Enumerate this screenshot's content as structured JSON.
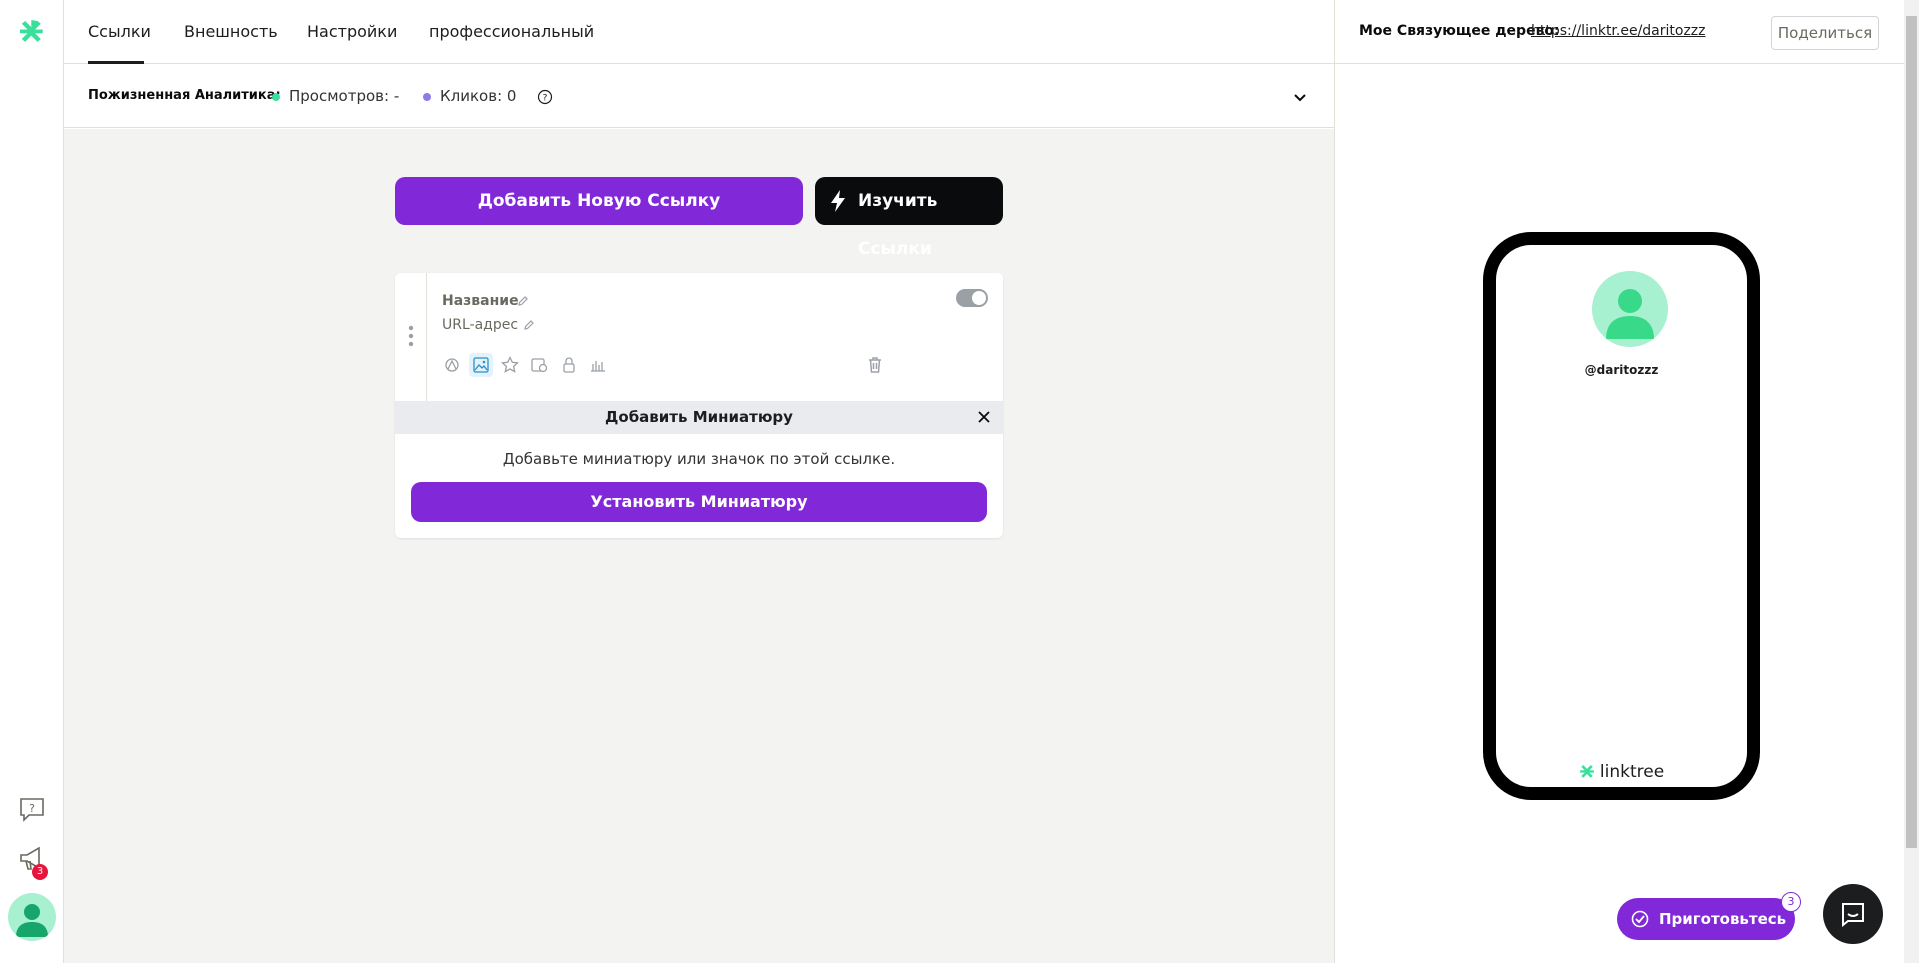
{
  "nav": {
    "tabs": [
      {
        "label": "Ссылки",
        "active": true
      },
      {
        "label": "Внешность"
      },
      {
        "label": "Настройки"
      },
      {
        "label": "профессиональный"
      }
    ]
  },
  "rail": {
    "notification_count": "3",
    "logo_icon": "linktree-logo-icon",
    "help_icon": "help-chat-icon",
    "announcement_icon": "megaphone-icon"
  },
  "analytics": {
    "label": "Пожизненная Аналитика:",
    "views_label": "Просмотров: -",
    "clicks_label": "Кликов: 0",
    "views_color": "#39e09b",
    "clicks_color": "#8b7de8"
  },
  "actions": {
    "add_link": "Добавить Новую Ссылку",
    "explore_links": "Изучить Ссылки"
  },
  "link_card": {
    "title_label": "Название",
    "url_label": "URL-адрес",
    "enabled": true,
    "toolbar_icons": [
      "bounce-icon",
      "thumbnail-icon",
      "star-icon",
      "schedule-icon",
      "lock-icon",
      "analytics-icon"
    ],
    "delete_icon": "trash-icon"
  },
  "thumbnail_panel": {
    "title": "Добавить Миниатюру",
    "description": "Добавьте миниатюру или значок по этой ссылке.",
    "button": "Установить Миниатюру"
  },
  "preview": {
    "tree_label": "Мое Связующее дерево:",
    "tree_url": "https://linktr.ee/daritozzz",
    "share_button": "Поделиться",
    "username": "@daritozzz",
    "brand": "linktree"
  },
  "floating": {
    "ready_button": "Приготовьтесь",
    "ready_count": "3",
    "chat_icon": "chat-icon"
  },
  "colors": {
    "accent": "#8129d9",
    "brand_green": "#39e09b",
    "dark": "#0a0b0d"
  }
}
